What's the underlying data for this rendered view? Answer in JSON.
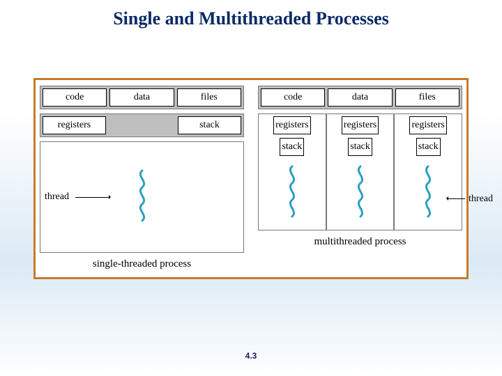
{
  "title": "Single and Multithreaded Processes",
  "page_number": "4.3",
  "shared": {
    "code": "code",
    "data": "data",
    "files": "files"
  },
  "per_thread": {
    "registers": "registers",
    "stack": "stack"
  },
  "labels": {
    "thread": "thread",
    "single_caption": "single-threaded process",
    "multi_caption": "multithreaded process"
  },
  "multi_thread_count": 3
}
